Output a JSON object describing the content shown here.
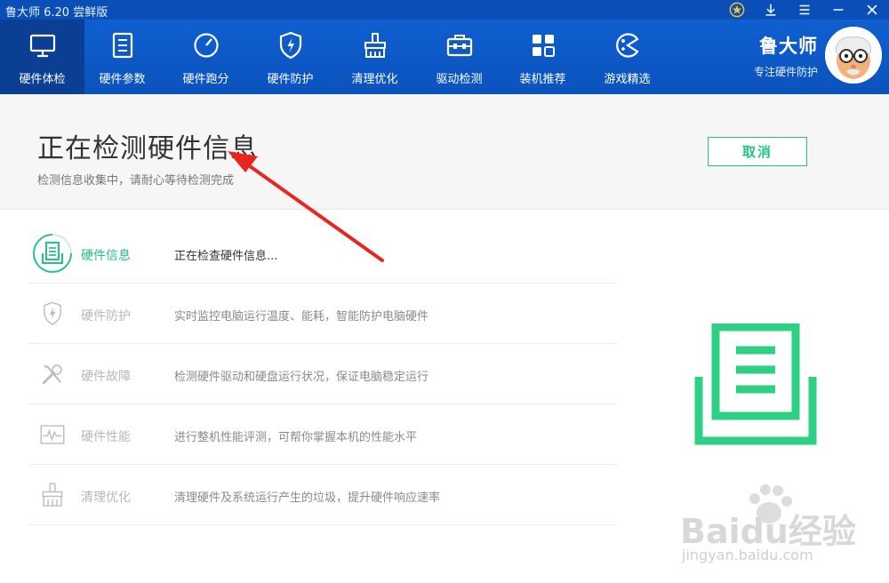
{
  "app": {
    "title": "鲁大师 6.20 尝鲜版"
  },
  "nav": {
    "items": [
      {
        "label": "硬件体检",
        "icon": "monitor-icon",
        "active": true
      },
      {
        "label": "硬件参数",
        "icon": "list-icon"
      },
      {
        "label": "硬件跑分",
        "icon": "speedometer-icon"
      },
      {
        "label": "硬件防护",
        "icon": "shield-bolt-icon"
      },
      {
        "label": "清理优化",
        "icon": "broom-icon"
      },
      {
        "label": "驱动检测",
        "icon": "toolbox-icon"
      },
      {
        "label": "装机推荐",
        "icon": "grid-icon"
      },
      {
        "label": "游戏精选",
        "icon": "gamepad-icon"
      }
    ]
  },
  "brand": {
    "name": "鲁大师",
    "slogan": "专注硬件防护"
  },
  "header": {
    "title": "正在检测硬件信息",
    "subtitle": "检测信息收集中，请耐心等待检测完成",
    "cancel_label": "取消"
  },
  "checks": [
    {
      "name": "硬件信息",
      "desc": "正在检查硬件信息...",
      "icon": "document-tray-icon",
      "state": "active"
    },
    {
      "name": "硬件防护",
      "desc": "实时监控电脑运行温度、能耗，智能防护电脑硬件",
      "icon": "shield-bolt-icon",
      "state": "pending"
    },
    {
      "name": "硬件故障",
      "desc": "检测硬件驱动和硬盘运行状况，保证电脑稳定运行",
      "icon": "tools-icon",
      "state": "pending"
    },
    {
      "name": "硬件性能",
      "desc": "进行整机性能评测，可帮你掌握本机的性能水平",
      "icon": "pulse-icon",
      "state": "pending"
    },
    {
      "name": "清理优化",
      "desc": "清理硬件及系统运行产生的垃圾，提升硬件响应速率",
      "icon": "broom-icon",
      "state": "pending"
    }
  ],
  "watermark": {
    "text": "Baidu经验",
    "url": "jingyan.baidu.com"
  },
  "colors": {
    "accent": "#27c28a",
    "nav_bg": "#0f5fd0",
    "nav_active": "#0a3f93",
    "annotation": "#e8261f"
  }
}
